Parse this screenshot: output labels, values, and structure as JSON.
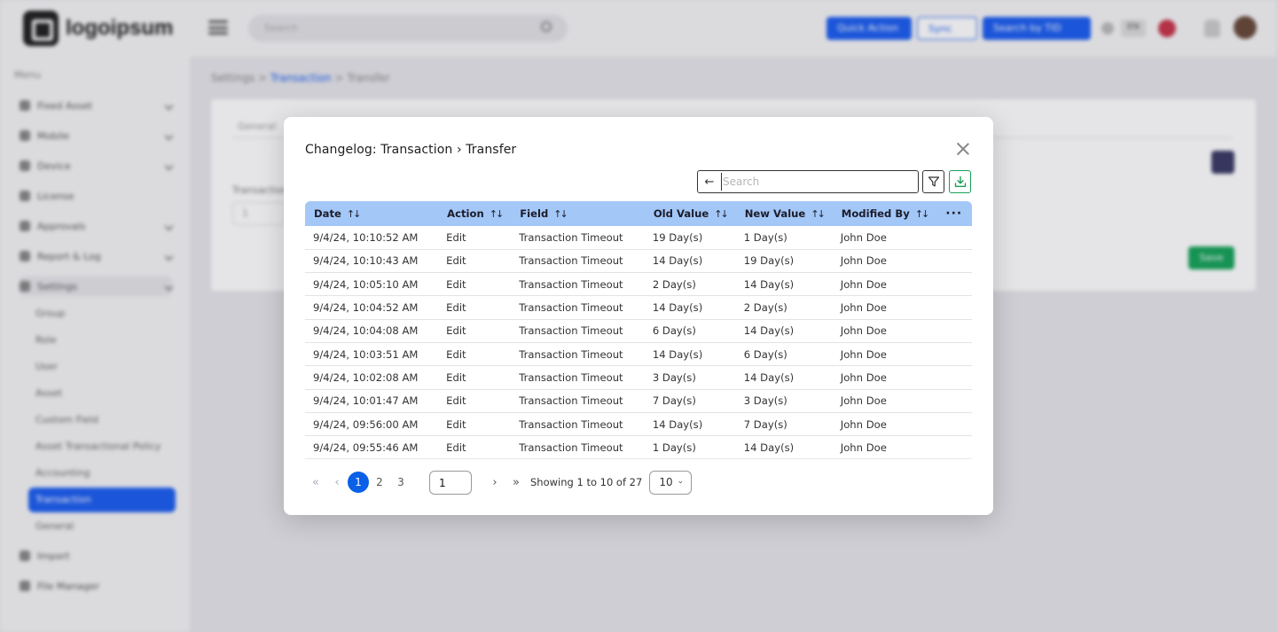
{
  "background": {
    "logo_text": "logoipsum",
    "top_search_placeholder": "Search",
    "buttons": [
      "Quick Action",
      "Sync",
      "Search by TID"
    ],
    "lang": "EN",
    "menu_title": "Menu",
    "sidebar_items": [
      "Fixed Asset",
      "Mobile",
      "Device",
      "License",
      "Approvals",
      "Report & Log",
      "Settings"
    ],
    "settings_sub": [
      "Group",
      "Role",
      "User",
      "Asset",
      "Custom Field",
      "Asset Transactional Policy",
      "Accounting",
      "Transaction",
      "General"
    ],
    "sidebar_bottom": [
      "Import",
      "File Manager"
    ],
    "breadcrumb": [
      "Settings",
      "Transaction",
      "Transfer"
    ],
    "card_tab": "General",
    "card_label": "Transaction",
    "card_input": "1",
    "card_save": "Save"
  },
  "modal": {
    "title": "Changelog: Transaction › Transfer",
    "search_placeholder": "Search",
    "columns": [
      "Date",
      "Action",
      "Field",
      "Old Value",
      "New Value",
      "Modified By"
    ],
    "rows": [
      [
        "9/4/24, 10:10:52 AM",
        "Edit",
        "Transaction Timeout",
        "19 Day(s)",
        "1 Day(s)",
        "John Doe"
      ],
      [
        "9/4/24, 10:10:43 AM",
        "Edit",
        "Transaction Timeout",
        "14 Day(s)",
        "19 Day(s)",
        "John Doe"
      ],
      [
        "9/4/24, 10:05:10 AM",
        "Edit",
        "Transaction Timeout",
        "2 Day(s)",
        "14 Day(s)",
        "John Doe"
      ],
      [
        "9/4/24, 10:04:52 AM",
        "Edit",
        "Transaction Timeout",
        "14 Day(s)",
        "2 Day(s)",
        "John Doe"
      ],
      [
        "9/4/24, 10:04:08 AM",
        "Edit",
        "Transaction Timeout",
        "6 Day(s)",
        "14 Day(s)",
        "John Doe"
      ],
      [
        "9/4/24, 10:03:51 AM",
        "Edit",
        "Transaction Timeout",
        "14 Day(s)",
        "6 Day(s)",
        "John Doe"
      ],
      [
        "9/4/24, 10:02:08 AM",
        "Edit",
        "Transaction Timeout",
        "3 Day(s)",
        "14 Day(s)",
        "John Doe"
      ],
      [
        "9/4/24, 10:01:47 AM",
        "Edit",
        "Transaction Timeout",
        "7 Day(s)",
        "3 Day(s)",
        "John Doe"
      ],
      [
        "9/4/24, 09:56:00 AM",
        "Edit",
        "Transaction Timeout",
        "14 Day(s)",
        "7 Day(s)",
        "John Doe"
      ],
      [
        "9/4/24, 09:55:46 AM",
        "Edit",
        "Transaction Timeout",
        "1 Day(s)",
        "14 Day(s)",
        "John Doe"
      ]
    ],
    "pagination": {
      "pages": [
        "1",
        "2",
        "3"
      ],
      "current_page": "1",
      "page_input": "1",
      "info": "Showing 1 to 10 of 27",
      "page_size": "10"
    }
  },
  "colors": {
    "header_bg": "#a3c7f7",
    "active_page": "#0a60e6",
    "download_icon": "#18a058",
    "brand_blue": "#1d5ef0"
  }
}
